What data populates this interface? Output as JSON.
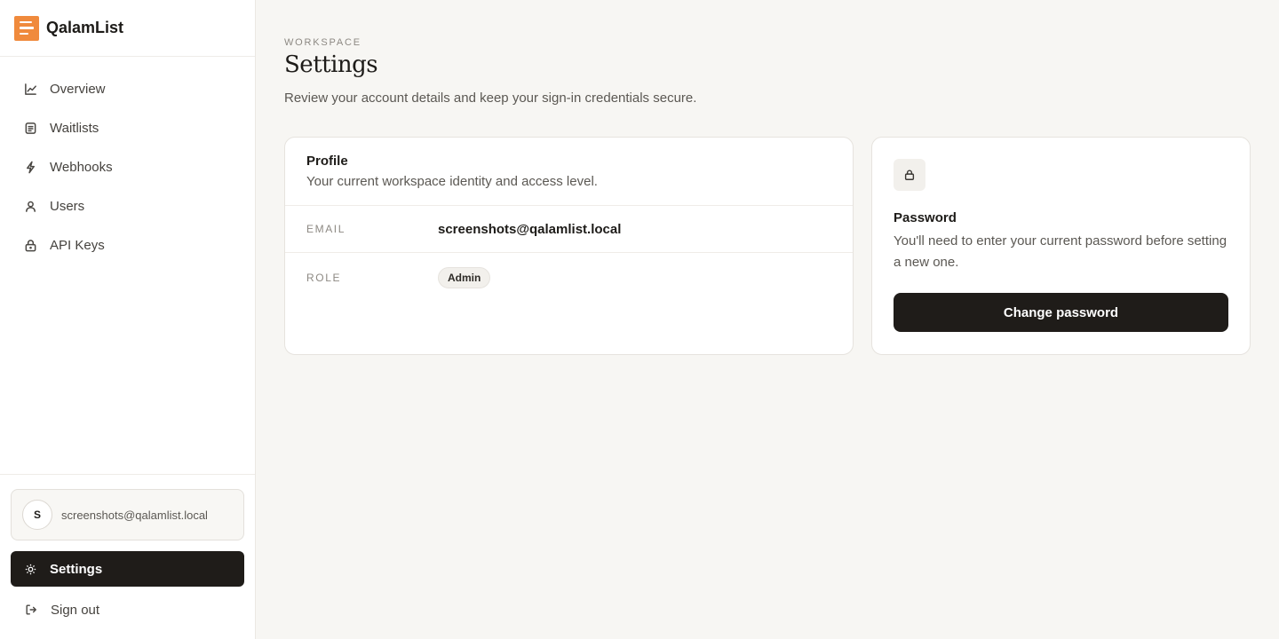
{
  "brand": {
    "name": "QalamList",
    "logo_color": "#f08a3c"
  },
  "sidebar": {
    "items": [
      {
        "label": "Overview",
        "icon": "chart-line-icon"
      },
      {
        "label": "Waitlists",
        "icon": "list-icon"
      },
      {
        "label": "Webhooks",
        "icon": "bolt-icon"
      },
      {
        "label": "Users",
        "icon": "user-icon"
      },
      {
        "label": "API Keys",
        "icon": "lock-icon"
      }
    ],
    "user": {
      "initial": "S",
      "email": "screenshots@qalamlist.local"
    },
    "settings_label": "Settings",
    "signout_label": "Sign out"
  },
  "header": {
    "eyebrow": "WORKSPACE",
    "title": "Settings",
    "subtitle": "Review your account details and keep your sign-in credentials secure."
  },
  "profile": {
    "title": "Profile",
    "description": "Your current workspace identity and access level.",
    "email_label": "EMAIL",
    "email_value": "screenshots@qalamlist.local",
    "role_label": "ROLE",
    "role_value": "Admin"
  },
  "password": {
    "title": "Password",
    "description": "You'll need to enter your current password before setting a new one.",
    "button_label": "Change password"
  },
  "colors": {
    "accent": "#f08a3c",
    "dark": "#1f1c19",
    "background": "#f7f6f3"
  }
}
